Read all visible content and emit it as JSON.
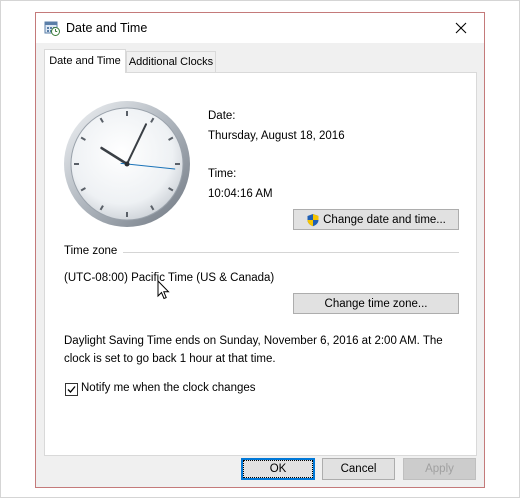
{
  "window": {
    "title": "Date and Time",
    "icons": {
      "app": "calendar-clock-icon",
      "close": "close-icon"
    }
  },
  "tabs": [
    {
      "label": "Date and Time",
      "active": true
    },
    {
      "label": "Additional Clocks",
      "active": false
    }
  ],
  "datetime": {
    "date_label": "Date:",
    "date_value": "Thursday, August 18, 2016",
    "time_label": "Time:",
    "time_value": "10:04:16 AM",
    "change_button": "Change date and time...",
    "change_button_icon": "uac-shield-icon"
  },
  "clock": {
    "hours": 10,
    "minutes": 4,
    "seconds": 16
  },
  "timezone": {
    "section_label": "Time zone",
    "value": "(UTC-08:00) Pacific Time (US & Canada)",
    "change_button": "Change time zone..."
  },
  "dst": {
    "line1": "Daylight Saving Time ends on Sunday, November 6, 2016 at 2:00 AM. The",
    "line2": "clock is set to go back 1 hour at that time."
  },
  "notify": {
    "label": "Notify me when the clock changes",
    "checked": true
  },
  "footer": {
    "ok": "OK",
    "cancel": "Cancel",
    "apply": "Apply"
  },
  "colors": {
    "accent": "#0078d7",
    "shield_blue": "#1f5fb4",
    "shield_yellow": "#f5c400",
    "second_hand": "#1a73b8"
  }
}
